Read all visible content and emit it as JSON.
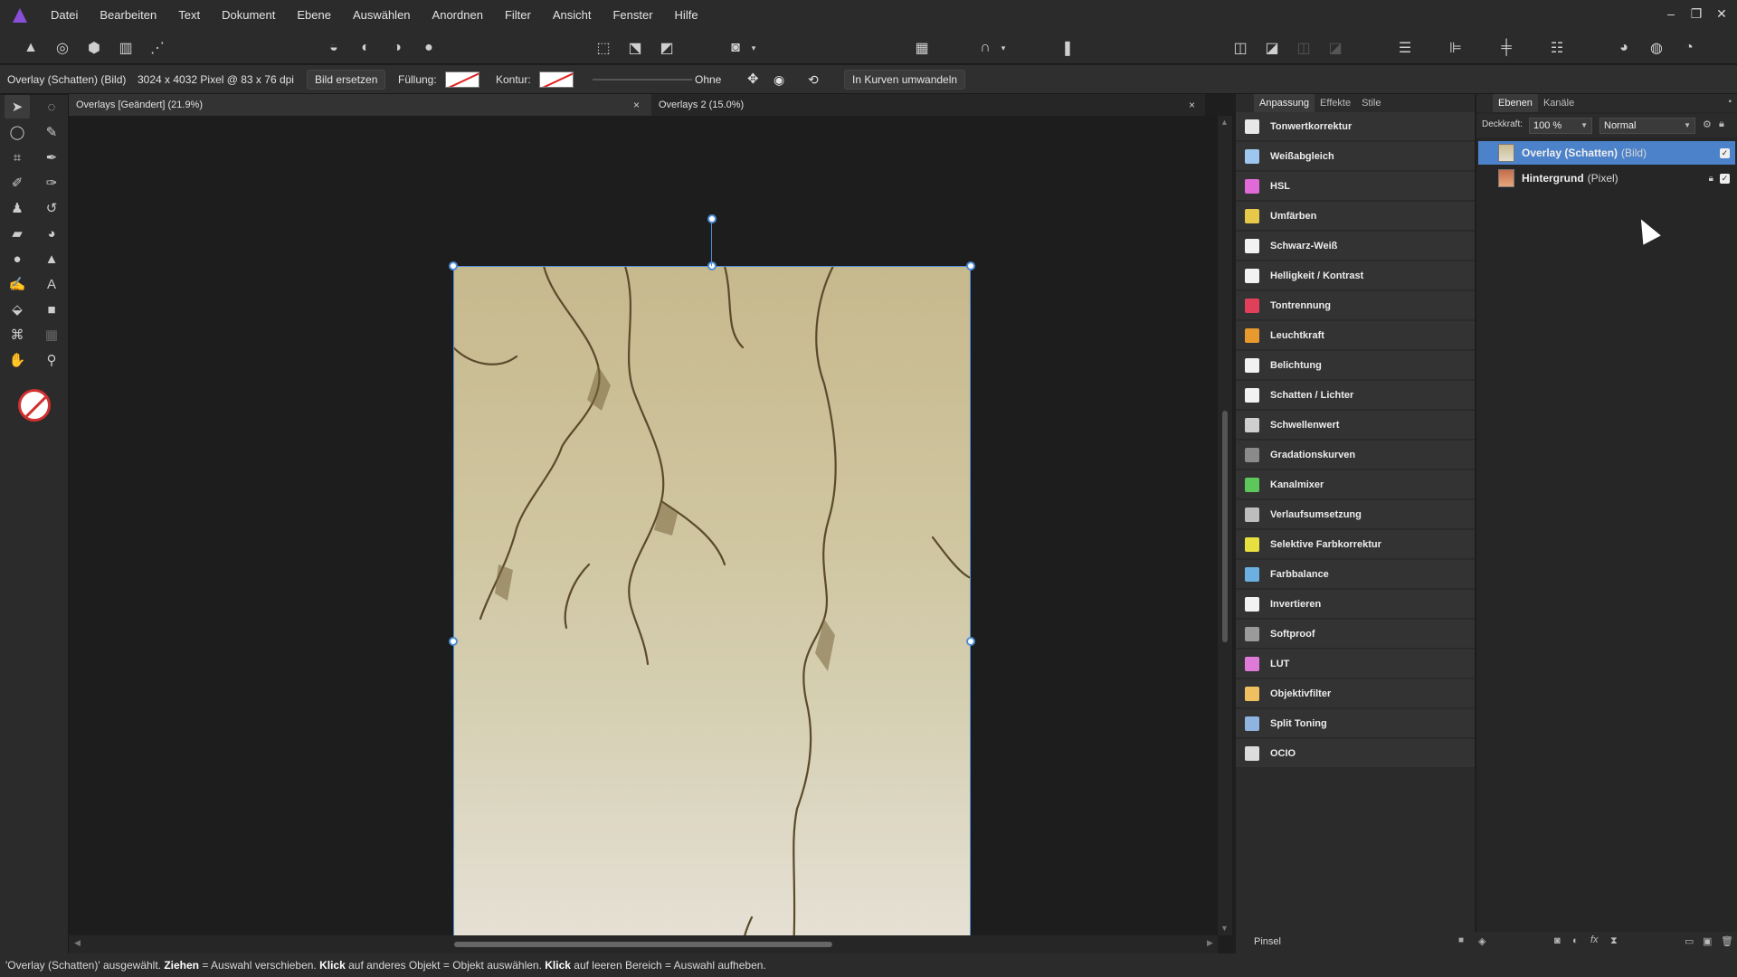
{
  "menubar": {
    "items": [
      "Datei",
      "Bearbeiten",
      "Text",
      "Dokument",
      "Ebene",
      "Auswählen",
      "Anordnen",
      "Filter",
      "Ansicht",
      "Fenster",
      "Hilfe"
    ],
    "window_controls": {
      "minimize": "–",
      "restore": "❐",
      "close": "✕"
    }
  },
  "context": {
    "selection_label": "Overlay (Schatten) (Bild)",
    "dimensions": "3024 x 4032 Pixel @ 83 x 76 dpi",
    "replace_button": "Bild ersetzen",
    "fill_label": "Füllung:",
    "stroke_label": "Kontur:",
    "stroke_width_value": "Ohne",
    "convert_button": "In Kurven umwandeln"
  },
  "documents": {
    "tabs": [
      {
        "title": "Overlays [Geändert] (21.9%)",
        "active": true
      },
      {
        "title": "Overlays 2 (15.0%)",
        "active": false
      }
    ],
    "close_glyph": "×"
  },
  "adjustments": {
    "tabs": [
      "Anpassung",
      "Effekte",
      "Stile"
    ],
    "active_tab": "Anpassung",
    "items": [
      {
        "label": "Tonwertkorrektur",
        "icon": "levels-icon",
        "color": "#e8e8e8"
      },
      {
        "label": "Weißabgleich",
        "icon": "white-balance-icon",
        "color": "#9ec7f0"
      },
      {
        "label": "HSL",
        "icon": "hsl-icon",
        "color": "#e06bd8"
      },
      {
        "label": "Umfärben",
        "icon": "recolor-icon",
        "color": "#e8c84a"
      },
      {
        "label": "Schwarz-Weiß",
        "icon": "black-white-icon",
        "color": "#f2f2f2"
      },
      {
        "label": "Helligkeit / Kontrast",
        "icon": "brightness-contrast-icon",
        "color": "#f2f2f2"
      },
      {
        "label": "Tontrennung",
        "icon": "posterize-icon",
        "color": "#e0405a"
      },
      {
        "label": "Leuchtkraft",
        "icon": "vibrance-icon",
        "color": "#e89a2e"
      },
      {
        "label": "Belichtung",
        "icon": "exposure-icon",
        "color": "#f2f2f2"
      },
      {
        "label": "Schatten / Lichter",
        "icon": "shadows-highlights-icon",
        "color": "#f2f2f2"
      },
      {
        "label": "Schwellenwert",
        "icon": "threshold-icon",
        "color": "#cfcfcf"
      },
      {
        "label": "Gradationskurven",
        "icon": "curves-icon",
        "color": "#8a8a8a"
      },
      {
        "label": "Kanalmixer",
        "icon": "channel-mixer-icon",
        "color": "#5cc85c"
      },
      {
        "label": "Verlaufsumsetzung",
        "icon": "gradient-map-icon",
        "color": "#bdbdbd"
      },
      {
        "label": "Selektive Farbkorrektur",
        "icon": "selective-color-icon",
        "color": "#e6e040"
      },
      {
        "label": "Farbbalance",
        "icon": "color-balance-icon",
        "color": "#6bb0e0"
      },
      {
        "label": "Invertieren",
        "icon": "invert-icon",
        "color": "#f2f2f2"
      },
      {
        "label": "Softproof",
        "icon": "soft-proof-icon",
        "color": "#9a9a9a"
      },
      {
        "label": "LUT",
        "icon": "lut-icon",
        "color": "#e07ad8"
      },
      {
        "label": "Objektivfilter",
        "icon": "lens-filter-icon",
        "color": "#f0c060"
      },
      {
        "label": "Split Toning",
        "icon": "split-toning-icon",
        "color": "#8fb4e0"
      },
      {
        "label": "OCIO",
        "icon": "ocio-icon",
        "color": "#dcdcdc"
      }
    ]
  },
  "layers": {
    "tabs": [
      "Ebenen",
      "Kanäle"
    ],
    "active_tab": "Ebenen",
    "opacity_label": "Deckkraft:",
    "opacity_value": "100 %",
    "blend_mode": "Normal",
    "rows": [
      {
        "name": "Overlay (Schatten)",
        "type": "(Bild)",
        "selected": true,
        "locked": false,
        "visible": true
      },
      {
        "name": "Hintergrund",
        "type": "(Pixel)",
        "selected": false,
        "locked": true,
        "visible": true
      }
    ]
  },
  "bottom_panel": {
    "brush_label": "Pinsel"
  },
  "status": {
    "part1": "'Overlay (Schatten)' ausgewählt. ",
    "bold1": "Ziehen",
    "part2": " = Auswahl verschieben. ",
    "bold2": "Klick",
    "part3": " auf anderes Objekt = Objekt auswählen. ",
    "bold3": "Klick",
    "part4": " auf leeren Bereich = Auswahl aufheben."
  },
  "colors": {
    "accent": "#4e8dd6",
    "selected_layer": "#4c82c9",
    "app_logo": "#8a4fd8"
  }
}
